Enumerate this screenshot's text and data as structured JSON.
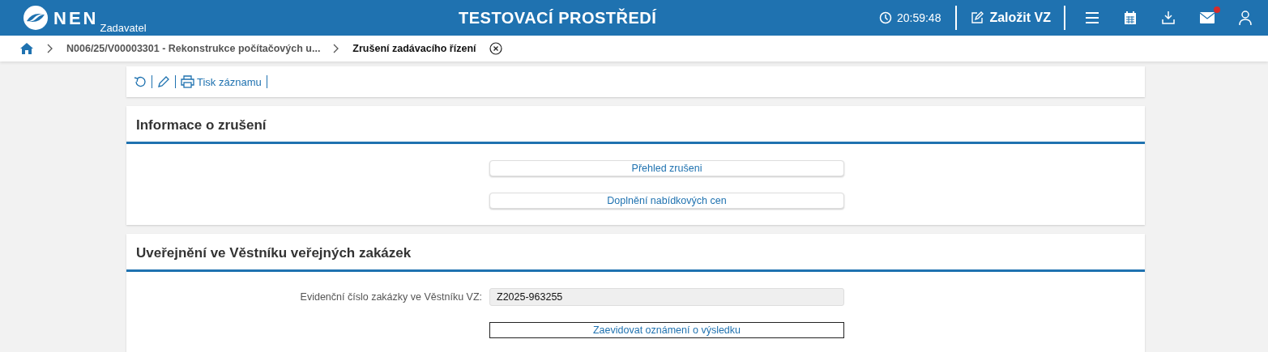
{
  "header": {
    "logo": "NEN",
    "subtitle": "Zadavatel",
    "environment": "TESTOVACÍ PROSTŘEDÍ",
    "time": "20:59:48",
    "create_button": "Založit VZ",
    "mail_unread": true
  },
  "breadcrumb": {
    "items": [
      "N006/25/V00003301 - Rekonstrukce počítačových u...",
      "Zrušení zadávacího řízení"
    ]
  },
  "toolbar": {
    "print": "Tisk záznamu"
  },
  "sections": [
    {
      "title": "Informace o zrušení",
      "rows": [
        {
          "kind": "button",
          "label": "Přehled zrušeni",
          "focused": false
        },
        {
          "kind": "button",
          "label": "Doplnění nabídkových cen",
          "focused": false
        }
      ]
    },
    {
      "title": "Uveřejnění ve Věstníku veřejných zakázek",
      "rows": [
        {
          "kind": "field",
          "label": "Evidenční číslo zakázky ve Věstníku VZ:",
          "value": "Z2025-963255"
        },
        {
          "kind": "button",
          "label": "Zaevidovat oznámení o výsledku",
          "focused": true
        }
      ]
    }
  ]
}
